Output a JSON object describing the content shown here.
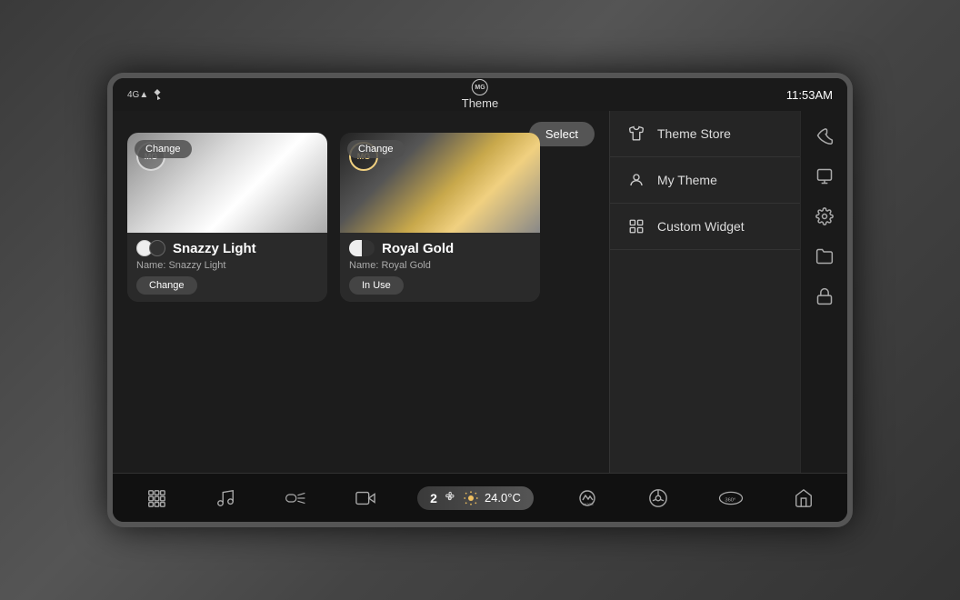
{
  "car_bg": "background",
  "status_bar": {
    "mg_logo": "MG",
    "title": "Theme",
    "signal": "4G",
    "bluetooth": "BT",
    "time": "11:53AM"
  },
  "select_button": "Select",
  "menu": {
    "items": [
      {
        "id": "theme-store",
        "icon": "shirt",
        "label": "Theme Store"
      },
      {
        "id": "my-theme",
        "icon": "user-circle",
        "label": "My Theme"
      },
      {
        "id": "custom-widget",
        "icon": "widget",
        "label": "Custom Widget"
      }
    ]
  },
  "themes": [
    {
      "id": "snazzy-light",
      "change_label": "Change",
      "name": "Snazzy Light",
      "name_label": "Name: Snazzy Light",
      "style": "light",
      "in_use": false
    },
    {
      "id": "royal-gold",
      "change_label": "Change",
      "name": "Royal Gold",
      "name_label": "Name: Royal Gold",
      "style": "gold",
      "in_use": true,
      "in_use_label": "In Use"
    }
  ],
  "sidebar_icons": [
    {
      "id": "phone",
      "icon": "phone"
    },
    {
      "id": "media",
      "icon": "media"
    },
    {
      "id": "settings",
      "icon": "gear"
    },
    {
      "id": "files",
      "icon": "folder"
    },
    {
      "id": "lock",
      "icon": "lock"
    }
  ],
  "bottom_bar": {
    "apps_icon": "⊞",
    "music_icon": "♪",
    "headlights_icon": "≡",
    "camera_icon": "⊙",
    "fan_speed": "2",
    "fan_icon": "≈",
    "sun_icon": "☀",
    "temperature": "24.0°C",
    "drive_mode_icon": "MODE",
    "steering_icon": "⊛",
    "camera_360": "360°",
    "home_icon": "⌂"
  }
}
